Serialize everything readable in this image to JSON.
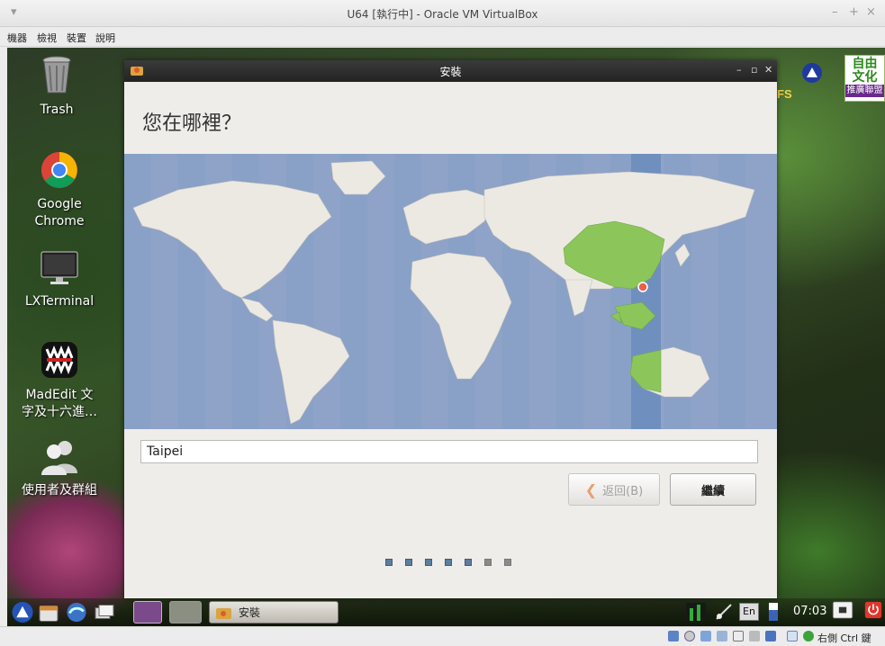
{
  "host": {
    "title": "U64 [執行中] - Oracle VM VirtualBox",
    "window_controls": [
      "–",
      "+",
      "×"
    ],
    "menu": [
      "機器",
      "檢視",
      "裝置",
      "說明"
    ],
    "status_right_text": "右側 Ctrl 鍵"
  },
  "desktop": {
    "icons": [
      {
        "label": "Trash",
        "icon": "trash-icon"
      },
      {
        "label": "Google\nChrome",
        "line1": "Google",
        "line2": "Chrome",
        "icon": "chrome-icon"
      },
      {
        "label": "LXTerminal",
        "icon": "monitor-icon"
      },
      {
        "line1": "MadEdit 文",
        "line2": "字及十六進…",
        "icon": "madedit-icon"
      },
      {
        "label": "使用者及群組",
        "icon": "users-icon"
      }
    ],
    "logo_text": {
      "top": "自由",
      "mid": "文化",
      "bottom": "推廣聯盟",
      "fs": "FS"
    }
  },
  "installer": {
    "title": "安裝",
    "heading": "您在哪裡？",
    "city_value": "Taipei",
    "back_label": "返回(B)",
    "next_label": "繼續",
    "steps_total": 7,
    "steps_done": 5
  },
  "panel": {
    "task_label": "安裝",
    "lang": "En",
    "clock": "07:03"
  }
}
